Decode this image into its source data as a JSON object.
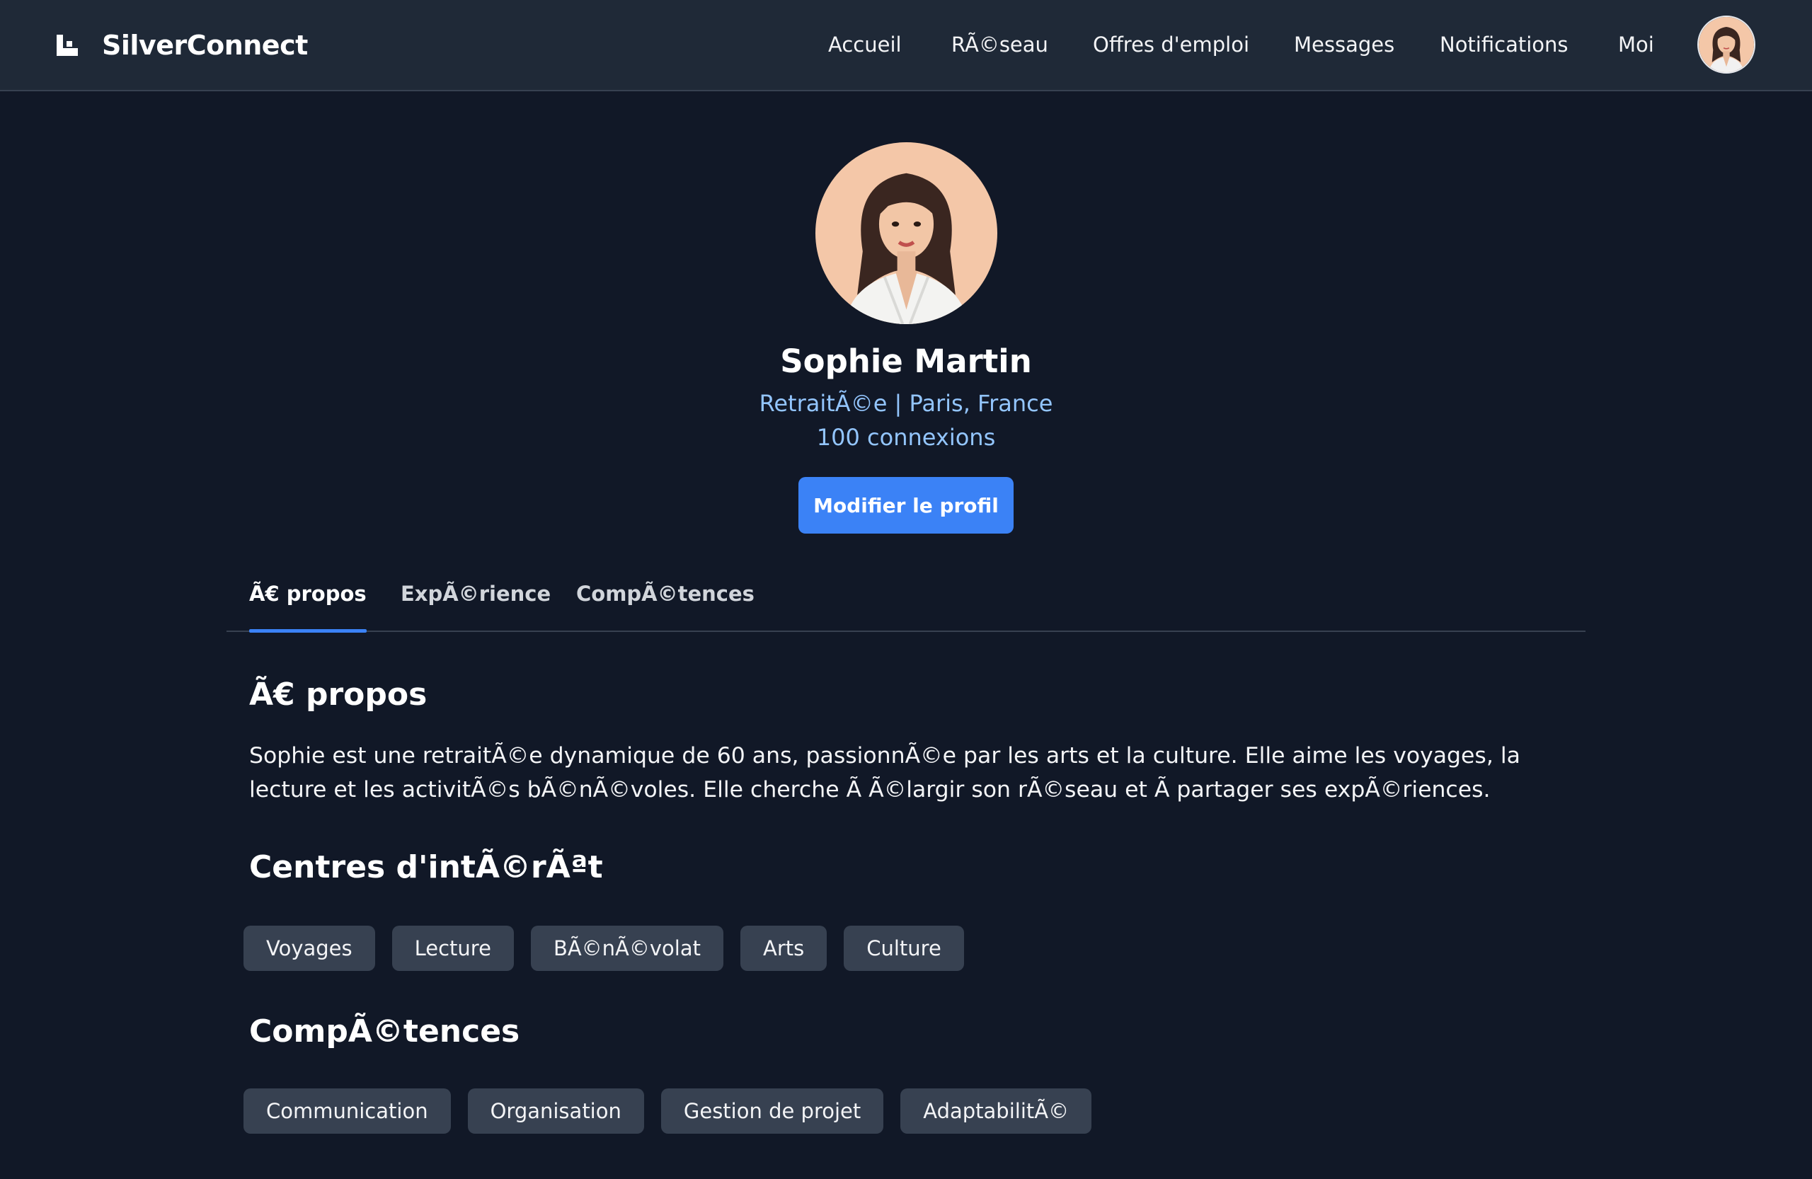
{
  "app": {
    "name": "SilverConnect"
  },
  "nav": {
    "items": [
      "Accueil",
      "RÃ©seau",
      "Offres d'emploi",
      "Messages",
      "Notifications",
      "Moi"
    ]
  },
  "profile": {
    "name": "Sophie Martin",
    "headline": "RetraitÃ©e | Paris, France",
    "connections": "100 connexions",
    "edit_button": "Modifier le profil"
  },
  "tabs": {
    "items": [
      "Ã€ propos",
      "ExpÃ©rience",
      "CompÃ©tences"
    ],
    "active_index": 0
  },
  "about": {
    "title": "Ã€ propos",
    "text": "Sophie est une retraitÃ©e dynamique de 60 ans, passionnÃ©e par les arts et la culture. Elle aime les voyages, la lecture et les activitÃ©s bÃ©nÃ©voles. Elle cherche Ã  Ã©largir son rÃ©seau et Ã  partager ses expÃ©riences."
  },
  "interests": {
    "title": "Centres d'intÃ©rÃªt",
    "items": [
      "Voyages",
      "Lecture",
      "BÃ©nÃ©volat",
      "Arts",
      "Culture"
    ]
  },
  "skills": {
    "title": "CompÃ©tences",
    "items": [
      "Communication",
      "Organisation",
      "Gestion de projet",
      "AdaptabilitÃ©"
    ]
  },
  "icons": {
    "logo": "logo-icon",
    "avatar": "user-avatar-portrait"
  },
  "colors": {
    "background": "#111827",
    "topbar": "#1f2937",
    "accent": "#3b82f6",
    "link_text": "#93c5fd",
    "chip": "#374151"
  }
}
